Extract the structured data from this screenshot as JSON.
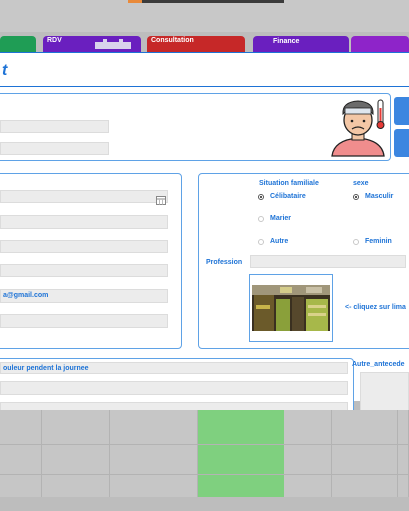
{
  "tabs": [
    {
      "label": "",
      "color": "#1f9d55"
    },
    {
      "label": "RDV",
      "color": "#6a1fbf"
    },
    {
      "label": "Consultation",
      "color": "#c62828"
    },
    {
      "label": "Finance",
      "color": "#6a1fbf"
    },
    {
      "label": "",
      "color": "#8e24c9"
    }
  ],
  "page": {
    "title_fragment": "t"
  },
  "contact": {
    "email_value": "a@gmail.com"
  },
  "situation": {
    "heading": "Situation familiale",
    "celibataire": "Célibataire",
    "marier": "Marier",
    "autre": "Autre"
  },
  "sexe": {
    "heading": "sexe",
    "masculin": "Masculir",
    "feminin": "Feminin"
  },
  "profession": {
    "label": "Profession",
    "value": ""
  },
  "photo": {
    "hint": "<- cliquez sur lima"
  },
  "symptoms": {
    "label": "ouleur pendent la journee"
  },
  "antecedents": {
    "label": "Autre_antecede"
  },
  "colors": {
    "accent": "#1e73d6",
    "grid_highlight": "#7fd07f"
  }
}
